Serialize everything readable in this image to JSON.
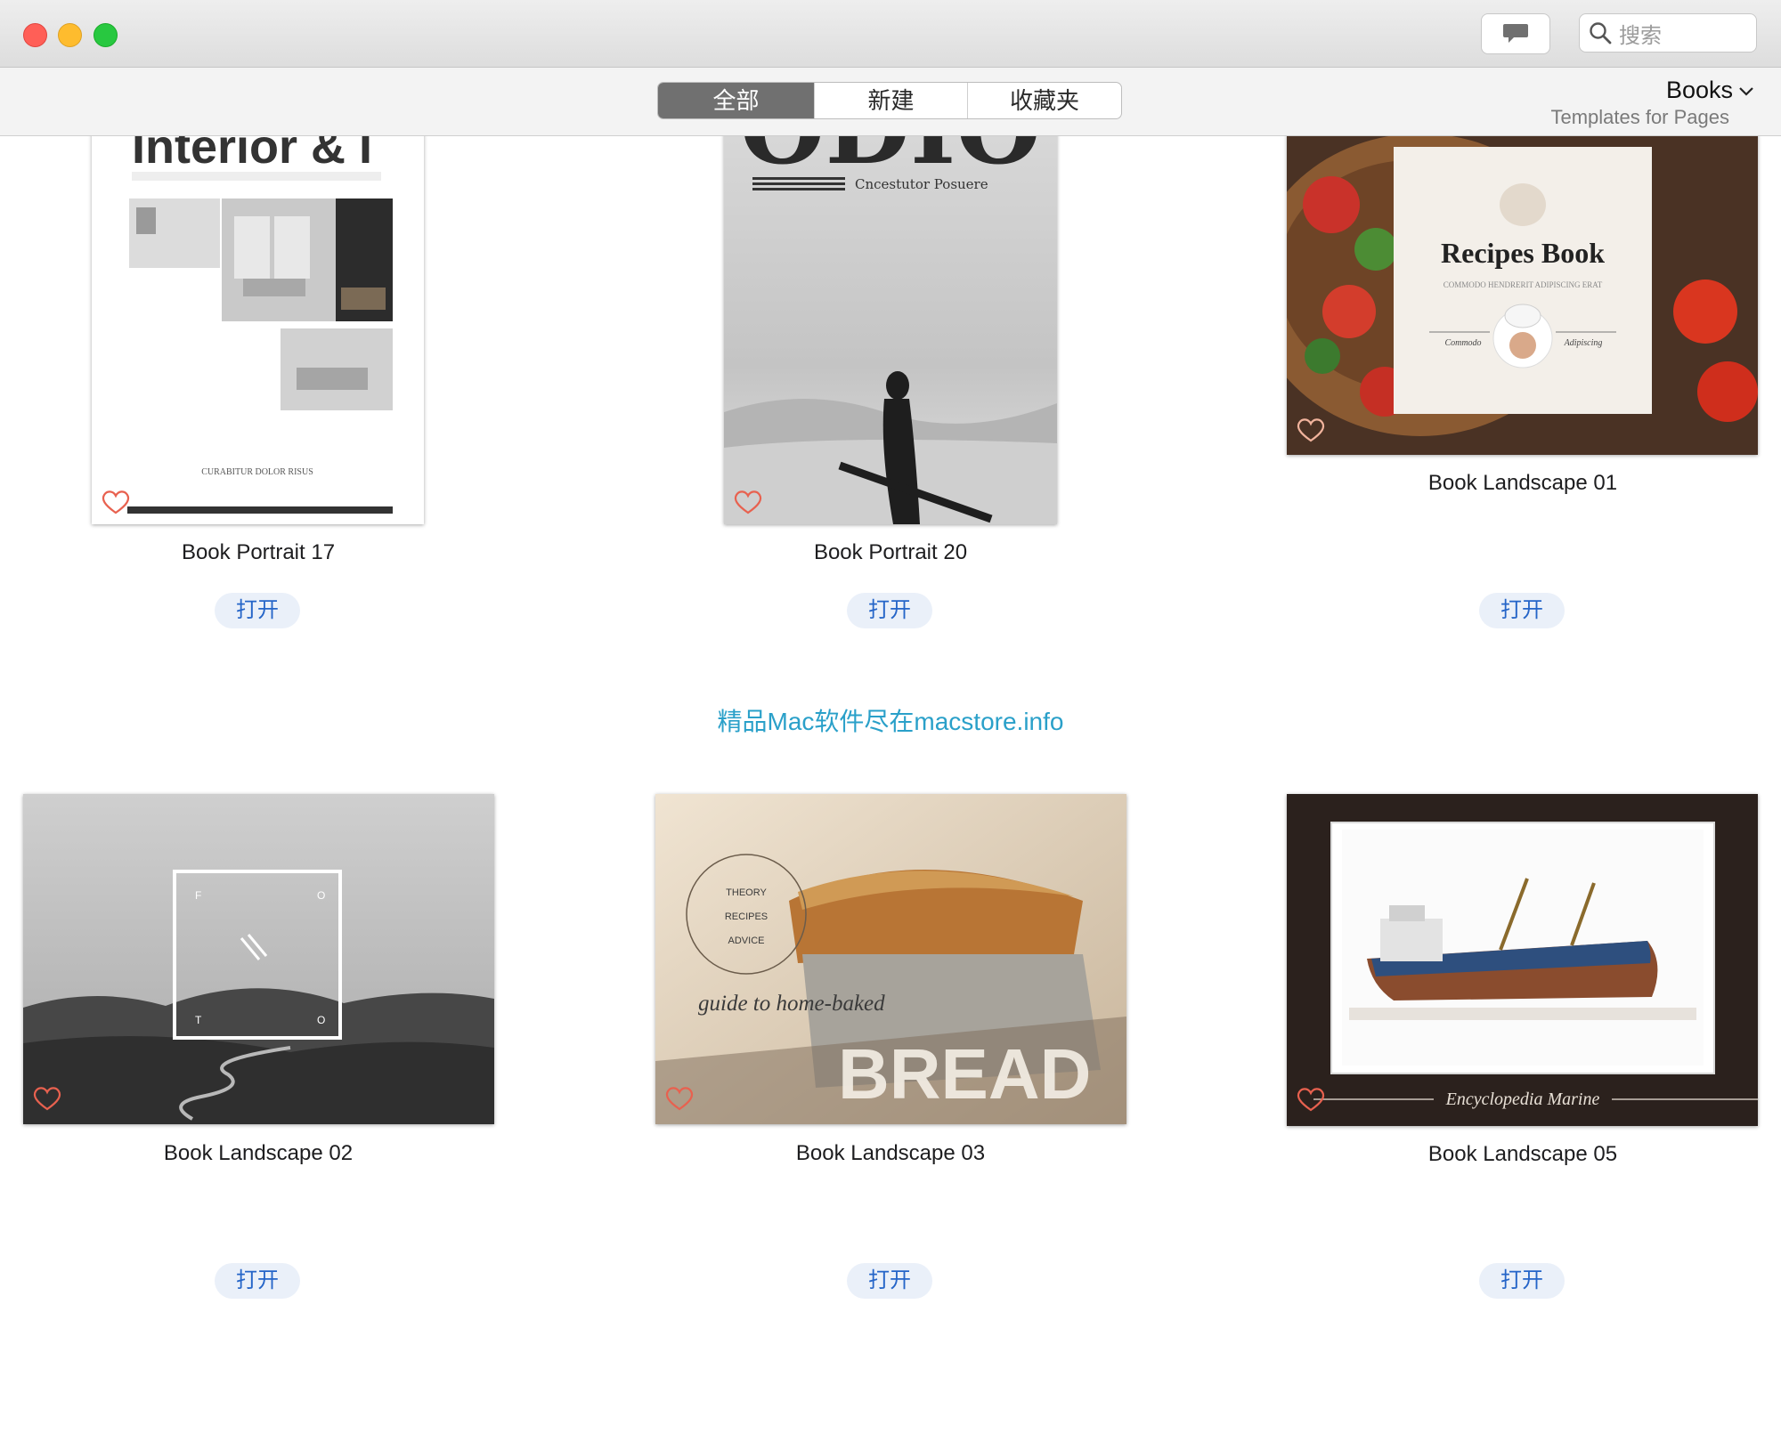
{
  "window": {
    "search_placeholder": "搜索"
  },
  "toolbar": {
    "tabs": [
      {
        "label": "全部",
        "active": true
      },
      {
        "label": "新建",
        "active": false
      },
      {
        "label": "收藏夹",
        "active": false
      }
    ],
    "category": {
      "title": "Books",
      "subtitle": "Templates for Pages"
    }
  },
  "templates": [
    {
      "name": "Book Portrait 17",
      "open_label": "打开",
      "cover_title": "Interior & I",
      "cover_footer": "CURABITUR DOLOR RISUS"
    },
    {
      "name": "Book Portrait 20",
      "open_label": "打开",
      "cover_title": "ODIO",
      "cover_subtitle": "Cncestutor Posuere"
    },
    {
      "name": "Book Landscape 01",
      "open_label": "打开",
      "cover_title": "Recipes Book",
      "cover_tagline": "COMMODO HENDRERIT ADIPISCING ERAT",
      "cover_left": "Commodo",
      "cover_right": "Adipiscing"
    },
    {
      "name": "Book Landscape 02",
      "open_label": "打开",
      "cover_letters": [
        "F",
        "O",
        "T",
        "O"
      ]
    },
    {
      "name": "Book Landscape 03",
      "open_label": "打开",
      "cover_circle": [
        "THEORY",
        "RECIPES",
        "ADVICE"
      ],
      "cover_script": "guide  to  home-baked",
      "cover_title": "BREAD"
    },
    {
      "name": "Book Landscape 05",
      "open_label": "打开",
      "cover_title": "Encyclopedia Marine"
    }
  ],
  "watermark": "精品Mac软件尽在macstore.info",
  "colors": {
    "accent": "#2565c8",
    "button_bg": "#eaf0f9",
    "watermark": "#2aa0c9",
    "heart": "#e8614f",
    "segment_active": "#707070"
  }
}
